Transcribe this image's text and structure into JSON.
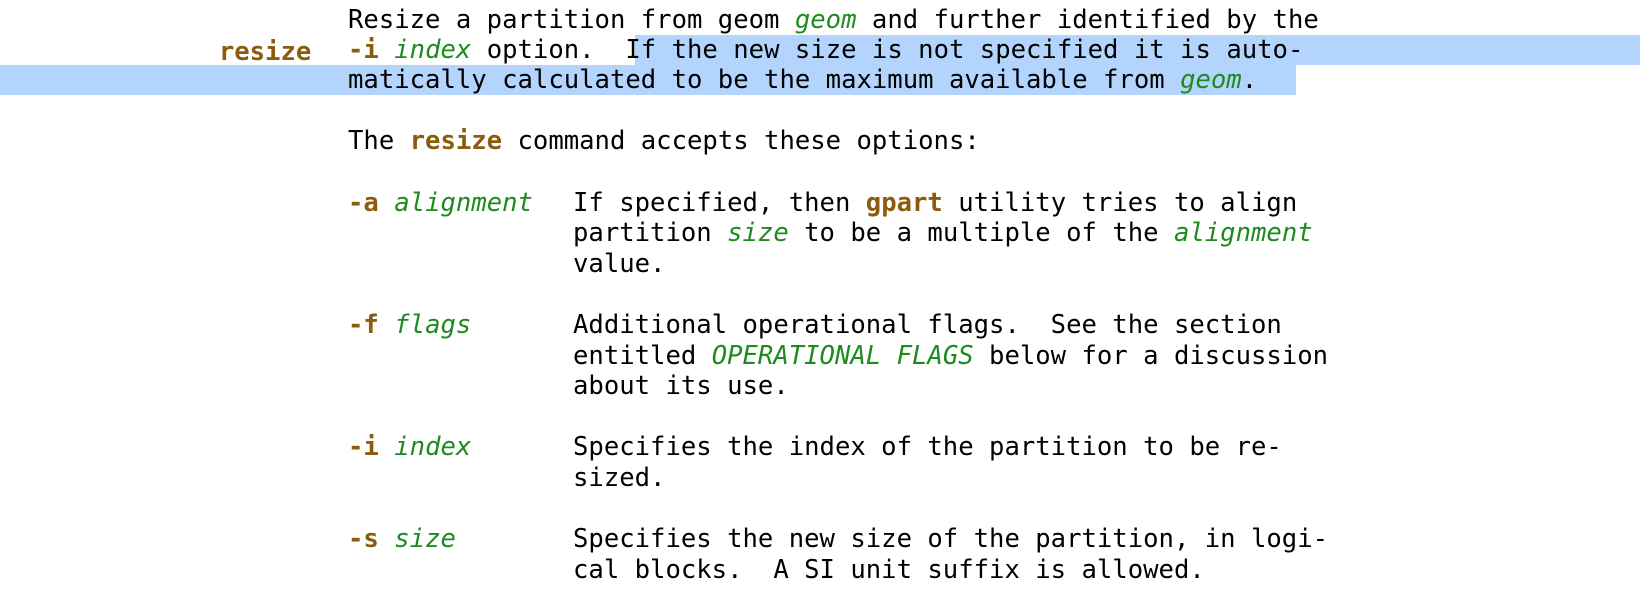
{
  "colors": {
    "command": "#8b5c0e",
    "argument": "#1f8a1f",
    "selection": "#b3d4fc",
    "text": "#000000"
  },
  "entry": {
    "command": "resize",
    "desc_1_a": "Resize a partition from geom ",
    "desc_1_arg": "geom",
    "desc_1_b": " and further identified by the",
    "desc_2_flag": "-i",
    "desc_2_sp": " ",
    "desc_2_arg": "index",
    "desc_2_a": " option.  ",
    "desc_2_sel": "If the new size is not specified it is auto-",
    "desc_3_sel_a": "matically calculated to be the maximum available from ",
    "desc_3_sel_arg": "geom",
    "desc_3_sel_b": ".",
    "accepts_a": "The ",
    "accepts_cmd": "resize",
    "accepts_b": " command accepts these options:"
  },
  "options": {
    "a": {
      "flag": "-a",
      "arg": "alignment",
      "l1_a": "If specified, then ",
      "l1_cmd": "gpart",
      "l1_b": " utility tries to align",
      "l2_a": "partition ",
      "l2_arg1": "size",
      "l2_b": " to be a multiple of the ",
      "l2_arg2": "alignment",
      "l3": "value."
    },
    "f": {
      "flag": "-f",
      "arg": "flags",
      "l1": "Additional operational flags.  See the section",
      "l2_a": "entitled ",
      "l2_arg": "OPERATIONAL FLAGS",
      "l2_b": " below for a discussion",
      "l3": "about its use."
    },
    "i": {
      "flag": "-i",
      "arg": "index",
      "l1": "Specifies the index of the partition to be re-",
      "l2": "sized."
    },
    "s": {
      "flag": "-s",
      "arg": "size",
      "l1": "Specifies the new size of the partition, in logi-",
      "l2": "cal blocks.  A SI unit suffix is allowed."
    }
  }
}
